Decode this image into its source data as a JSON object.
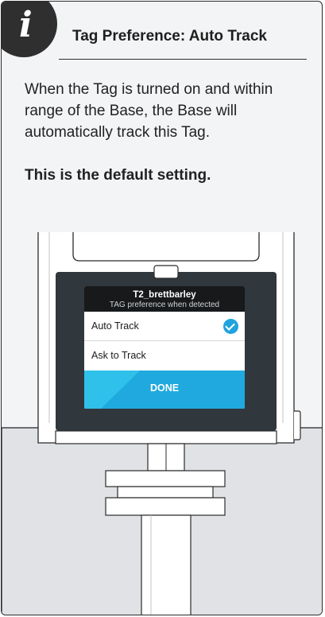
{
  "header": {
    "icon": "info-icon",
    "icon_glyph": "i",
    "title": "Tag Preference: Auto Track"
  },
  "content": {
    "description": "When the Tag is turned on and within range of the Base, the Base will automatically track this Tag.",
    "note": "This is the default setting."
  },
  "device_screen": {
    "tag_name": "T2_brettbarley",
    "subtitle": "TAG preference when detected",
    "options": [
      {
        "label": "Auto Track",
        "selected": true
      },
      {
        "label": "Ask to Track",
        "selected": false
      }
    ],
    "done_label": "DONE",
    "accent_color": "#20a9de",
    "check_icon": "checkmark-icon"
  },
  "colors": {
    "badge": "#2f2f2f",
    "screen_bezel": "#30373d",
    "lower_panel": "#e0e2e5"
  }
}
